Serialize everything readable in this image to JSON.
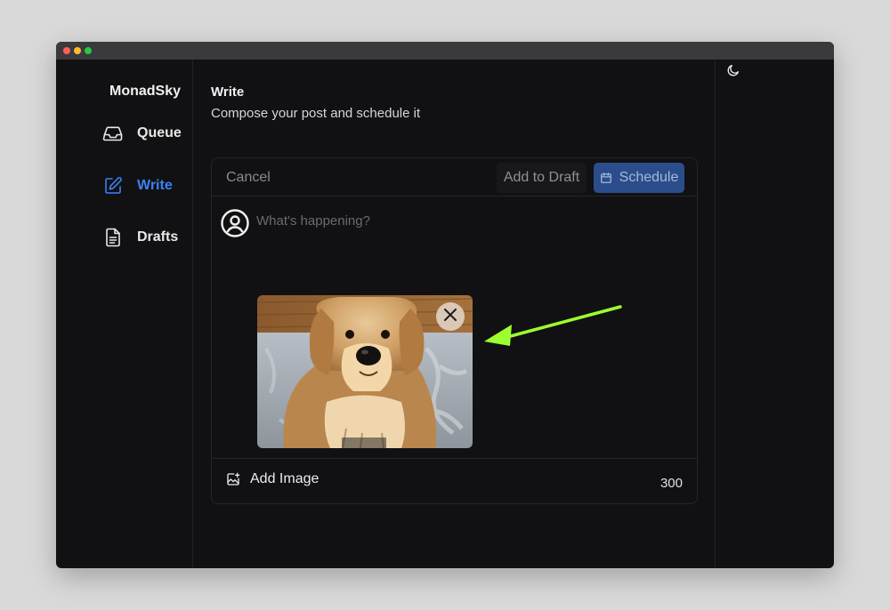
{
  "app": {
    "brand": "MonadSky"
  },
  "sidebar": {
    "items": [
      {
        "label": "Queue",
        "icon": "inbox-icon",
        "active": false
      },
      {
        "label": "Write",
        "icon": "pencil-square-icon",
        "active": true
      },
      {
        "label": "Drafts",
        "icon": "document-icon",
        "active": false
      }
    ]
  },
  "page": {
    "title": "Write",
    "subtitle": "Compose your post and schedule it"
  },
  "composer": {
    "cancel_label": "Cancel",
    "draft_label": "Add to Draft",
    "schedule_label": "Schedule",
    "placeholder": "What's happening?",
    "value": "",
    "attachment": {
      "kind": "dog-photo",
      "remove_icon": "close-icon"
    },
    "add_image_label": "Add Image",
    "char_count": "300"
  },
  "theme": {
    "toggle_icon": "moon-icon"
  },
  "colors": {
    "accent": "#3b82f6",
    "schedule_button": "#2b4d8c",
    "annotation_arrow": "#9eff2e",
    "background": "#111113"
  }
}
